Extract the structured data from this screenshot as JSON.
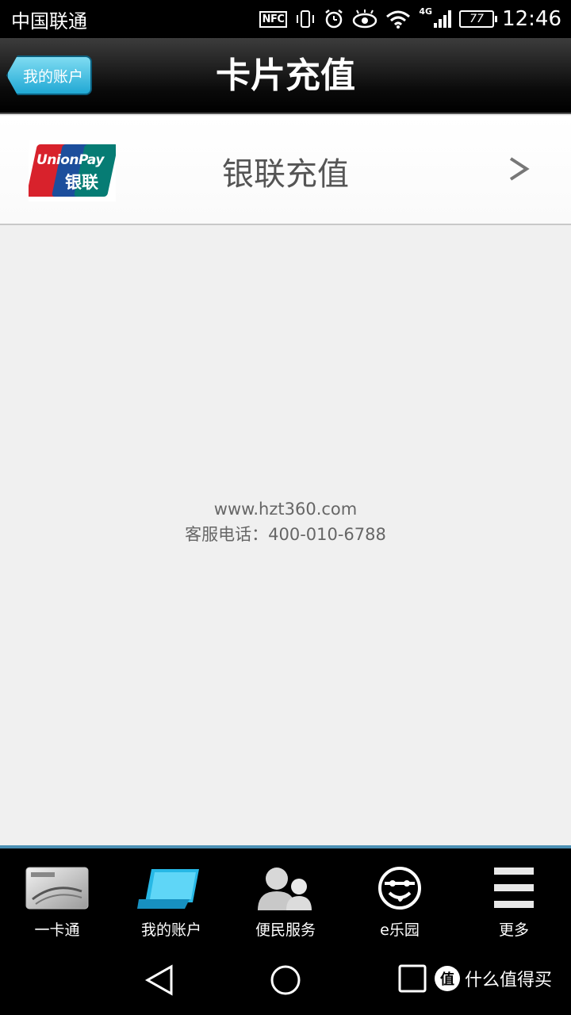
{
  "status_bar": {
    "carrier": "中国联通",
    "nfc": "NFC",
    "network": "4G",
    "battery": "77",
    "time": "12:46"
  },
  "header": {
    "back_label": "我的账户",
    "title": "卡片充值"
  },
  "recharge_option": {
    "logo_text_en": "UnionPay",
    "logo_text_cn": "银联",
    "label": "银联充值"
  },
  "footer_info": {
    "website": "www.hzt360.com",
    "hotline": "客服电话：400-010-6788"
  },
  "tabs": [
    {
      "label": "一卡通",
      "icon": "card-icon"
    },
    {
      "label": "我的账户",
      "icon": "account-icon",
      "active": true
    },
    {
      "label": "便民服务",
      "icon": "people-icon"
    },
    {
      "label": "e乐园",
      "icon": "smiley-icon"
    },
    {
      "label": "更多",
      "icon": "menu-icon"
    }
  ],
  "watermark": {
    "badge": "值",
    "text": "什么值得买"
  },
  "colors": {
    "back_button": "#20a8d4",
    "tab_border": "#4b90b4",
    "unionpay_red": "#d8222c",
    "unionpay_blue": "#1c4e9c",
    "unionpay_green": "#067c74"
  }
}
